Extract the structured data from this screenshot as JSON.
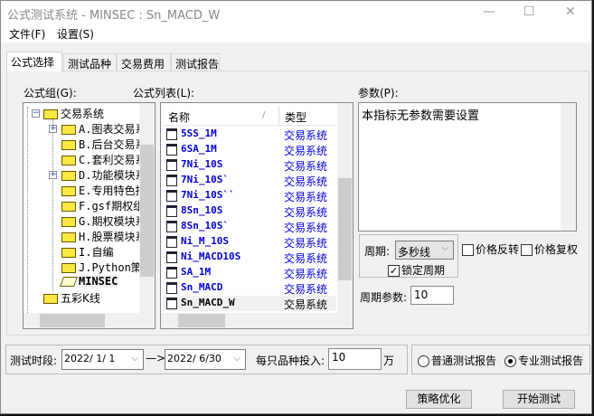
{
  "window": {
    "title": "公式测试系统 - MINSEC : Sn_MACD_W",
    "minimize": "—",
    "maximize": "☐",
    "close": "✕"
  },
  "menu": [
    "文件(F)",
    "设置(S)"
  ],
  "tabs": [
    "公式选择",
    "测试品种",
    "交易费用",
    "测试报告"
  ],
  "group_label": "公式组(G):",
  "list_label": "公式列表(L):",
  "param_label": "参数(P):",
  "tree": {
    "root": "交易系统",
    "children": [
      "A.图表交易系",
      "B.后台交易系",
      "C.套利交易系",
      "D.功能模块系",
      "E.专用特色指",
      "F.gsf期权组",
      "G.期权模块系",
      "H.股票模块系",
      "I.自编",
      "J.Python策略",
      "MINSEC"
    ],
    "next_root": "五彩K线"
  },
  "list": {
    "col_name": "名称",
    "col_type": "类型",
    "sort": "/",
    "rows": [
      {
        "name": "5SS_1M",
        "type": "交易系统"
      },
      {
        "name": "6SA_1M",
        "type": "交易系统"
      },
      {
        "name": "7Ni_10S",
        "type": "交易系统"
      },
      {
        "name": "7Ni_10S`",
        "type": "交易系统"
      },
      {
        "name": "7Ni_10S``",
        "type": "交易系统"
      },
      {
        "name": "8Sn_10S",
        "type": "交易系统"
      },
      {
        "name": "8Sn_10S`",
        "type": "交易系统"
      },
      {
        "name": "Ni_M_10S",
        "type": "交易系统"
      },
      {
        "name": "Ni_MACD10S",
        "type": "交易系统"
      },
      {
        "name": "SA_1M",
        "type": "交易系统"
      },
      {
        "name": "Sn_MACD",
        "type": "交易系统"
      },
      {
        "name": "Sn_MACD_W",
        "type": "交易系统"
      }
    ]
  },
  "params_text": "本指标无参数需要设置",
  "period": {
    "label": "周期:",
    "value": "多秒线",
    "lock": "锁定周期",
    "lock_checked": true
  },
  "price_reverse": {
    "label": "价格反转",
    "checked": false
  },
  "price_adjust": {
    "label": "价格复权",
    "checked": false
  },
  "period_param": {
    "label": "周期参数:",
    "value": "10"
  },
  "test_range": {
    "label": "测试时段:",
    "start": "2022/ 1/ 1",
    "arrow": "—>",
    "end": "2022/ 6/30"
  },
  "invest": {
    "label": "每只品种投入:",
    "value": "10",
    "unit": "万"
  },
  "report": {
    "normal": "普通测试报告",
    "pro": "专业测试报告",
    "selected": "pro"
  },
  "buttons": {
    "optimize": "策略优化",
    "start": "开始测试"
  }
}
